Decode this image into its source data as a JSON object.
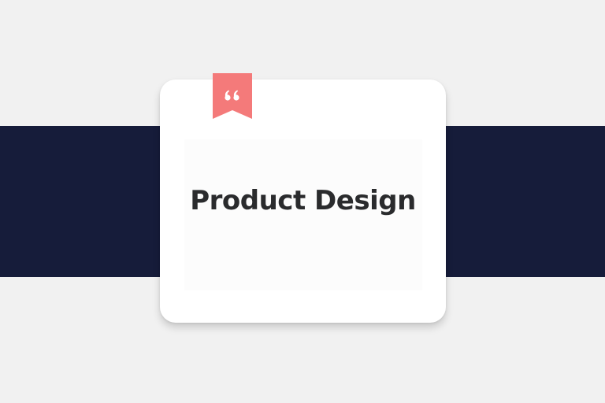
{
  "card": {
    "title": "Product Design"
  },
  "bookmark": {
    "icon": "quote-bookmark-icon",
    "color": "#f47a7a"
  },
  "colors": {
    "background": "#f1f1f1",
    "band": "#161c3a",
    "card": "#ffffff",
    "title_text": "#2a2b2d"
  }
}
